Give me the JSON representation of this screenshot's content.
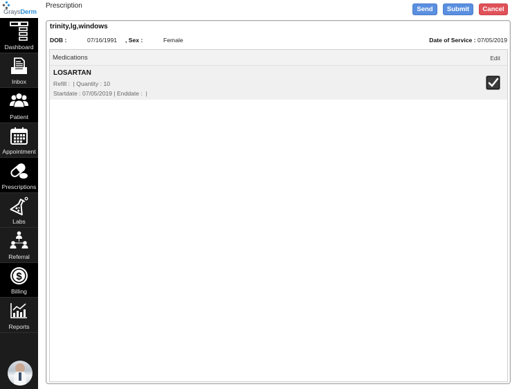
{
  "brand": {
    "name_part1": "Grays",
    "name_part2": "Derm"
  },
  "sidebar": {
    "items": [
      {
        "label": "Dashboard",
        "icon": "dashboard-icon"
      },
      {
        "label": "Inbox",
        "icon": "inbox-tray-icon"
      },
      {
        "label": "Patient",
        "icon": "people-icon"
      },
      {
        "label": "Appointment",
        "icon": "calendar-icon"
      },
      {
        "label": "Prescriptions",
        "icon": "pill-icon"
      },
      {
        "label": "Labs",
        "icon": "flask-icon"
      },
      {
        "label": "Referral",
        "icon": "referral-tree-icon"
      },
      {
        "label": "Billing",
        "icon": "dollar-circle-icon"
      },
      {
        "label": "Reports",
        "icon": "bar-chart-icon"
      }
    ],
    "avatar": "doctor-avatar"
  },
  "header": {
    "title": "Prescription",
    "buttons": {
      "send": "Send",
      "submit": "Submit",
      "cancel": "Cancel"
    },
    "colors": {
      "primary": "#5b8fe0",
      "danger": "#e0525a"
    }
  },
  "patient": {
    "name": "trinity,lg,windows",
    "dob_label": "DOB :",
    "dob": "07/16/1991",
    "sex_label": ", Sex :",
    "sex": "Female",
    "dos_label": "Date of Service :",
    "dos": "07/05/2019"
  },
  "medications": {
    "title": "Medications",
    "edit_label": "Edit",
    "items": [
      {
        "name": "LOSARTAN",
        "line1": "Refill :  | Quantity : 10",
        "line2": "Startdate : 07/05/2019 | Enddate :  |",
        "checked": true
      }
    ]
  }
}
